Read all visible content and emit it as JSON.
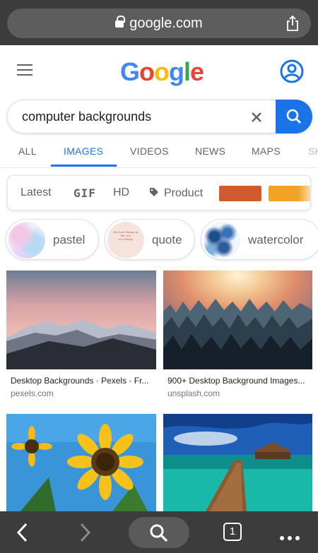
{
  "browser": {
    "url": "google.com",
    "tab_count": "1"
  },
  "google": {
    "logo": [
      "G",
      "o",
      "o",
      "g",
      "l",
      "e"
    ],
    "logo_colors": [
      "#4285f4",
      "#ea4335",
      "#fbbc05",
      "#4285f4",
      "#34a853",
      "#ea4335"
    ]
  },
  "search": {
    "query": "computer backgrounds"
  },
  "tabs": [
    {
      "label": "ALL"
    },
    {
      "label": "IMAGES"
    },
    {
      "label": "VIDEOS"
    },
    {
      "label": "NEWS"
    },
    {
      "label": "MAPS"
    },
    {
      "label": "SH"
    }
  ],
  "filters": {
    "latest": "Latest",
    "gif": "GIF",
    "hd": "HD",
    "product": "Product",
    "swatch_colors": [
      "#d35a2c",
      "#f0a324"
    ]
  },
  "chips": [
    {
      "label": "pastel"
    },
    {
      "label": "quote"
    },
    {
      "label": "watercolor"
    }
  ],
  "quote_thumb_text": "the best things in life are\nnot things",
  "results": [
    {
      "title": "Desktop Backgrounds · Pexels · Fr...",
      "source": "pexels.com"
    },
    {
      "title": "900+ Desktop Background Images...",
      "source": "unsplash.com"
    },
    {
      "title": "",
      "source": ""
    },
    {
      "title": "",
      "source": ""
    }
  ],
  "colors": {
    "accent": "#1a73e8",
    "browser_chrome": "#3c3c3c"
  }
}
